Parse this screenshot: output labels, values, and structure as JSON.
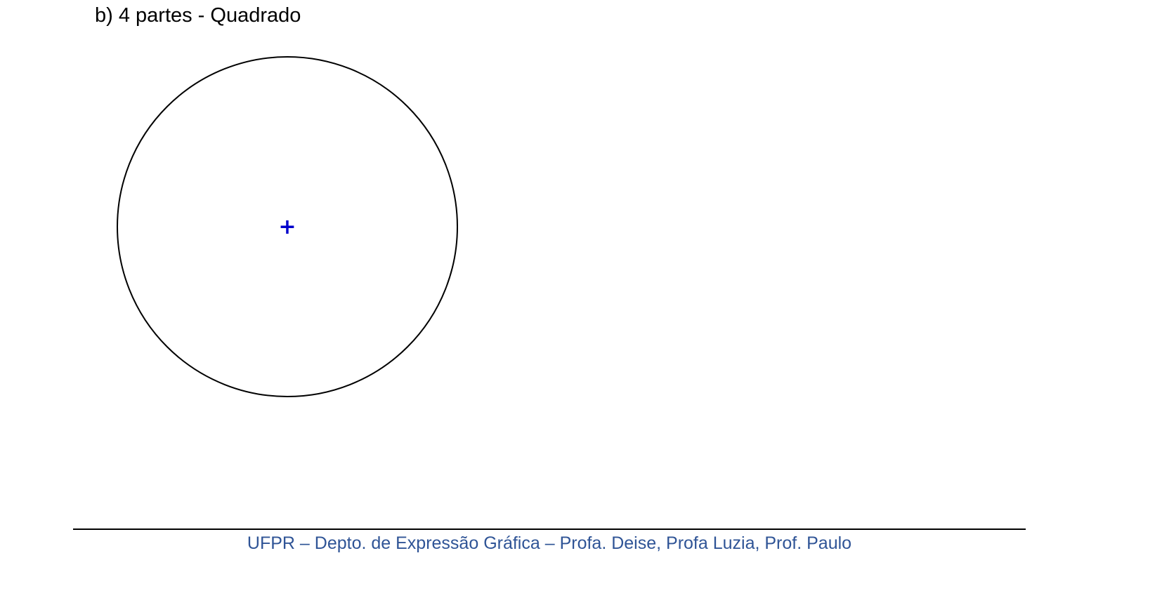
{
  "heading": "b) 4 partes - Quadrado",
  "figure": {
    "shape": "circle",
    "stroke_color": "#000000",
    "center_mark": "+",
    "center_mark_color": "#0000cc"
  },
  "footer": {
    "text": "UFPR – Depto. de Expressão Gráfica – Profa. Deise, Profa Luzia, Prof. Paulo",
    "color": "#2f5496"
  }
}
